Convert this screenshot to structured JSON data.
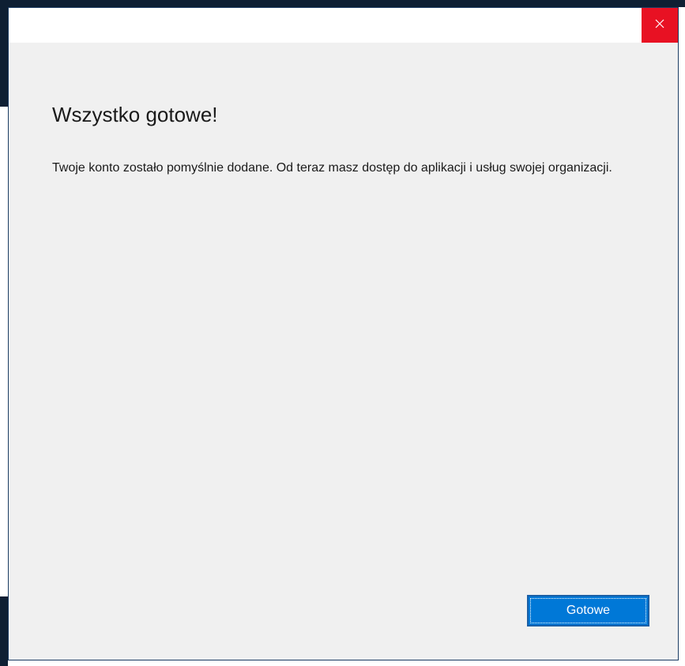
{
  "window": {
    "close_icon": "close-icon"
  },
  "content": {
    "title": "Wszystko gotowe!",
    "message": "Twoje konto zostało pomyślnie dodane. Od teraz masz dostęp do aplikacji i usług swojej organizacji."
  },
  "actions": {
    "done_label": "Gotowe"
  },
  "colors": {
    "accent": "#0078d7",
    "close_bg": "#e81123",
    "dialog_bg": "#f0f0f0"
  }
}
